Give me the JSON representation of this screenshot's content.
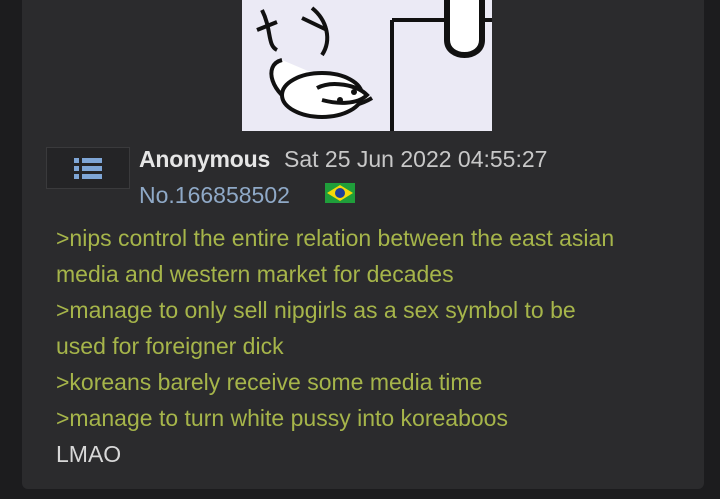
{
  "post": {
    "author": "Anonymous",
    "datetime": "Sat 25 Jun 2022 04:55:27",
    "number": "No.166858502",
    "flag_icon": "brazil-flag-icon",
    "menu_icon": "list-menu-icon",
    "lines": [
      {
        "text": ">nips control the entire relation between the east asian",
        "kind": "quote"
      },
      {
        "text": "media and western market for decades",
        "kind": "quote"
      },
      {
        "text": ">manage to only sell nipgirls as a sex symbol to be",
        "kind": "quote"
      },
      {
        "text": "used for foreigner dick",
        "kind": "quote"
      },
      {
        "text": ">koreans barely receive some media time",
        "kind": "quote"
      },
      {
        "text": ">manage to turn white pussy into koreaboos",
        "kind": "quote"
      },
      {
        "text": "LMAO",
        "kind": "plain"
      }
    ]
  },
  "colors": {
    "background": "#1c1c1e",
    "post_background": "#2b2b2d",
    "greentext": "#a6b54a",
    "post_number": "#8fa9c7",
    "menu_icon": "#7fa6d6"
  }
}
